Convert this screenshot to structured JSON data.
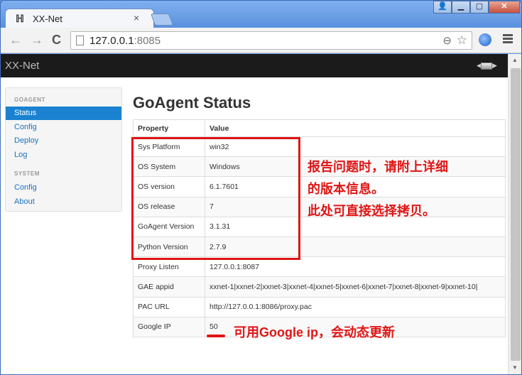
{
  "window": {
    "tab_title": "XX-Net",
    "tab_close": "×",
    "tab_icon": "ladder-icon",
    "buttons": [
      "user-icon",
      "minimize-icon",
      "maximize-icon",
      "close-icon"
    ],
    "button_glyphs": [
      "👤",
      "▁",
      "▢",
      "✕"
    ]
  },
  "toolbar": {
    "back": "←",
    "forward": "→",
    "reload": "C",
    "url_host": "127.0.0.1",
    "url_port": ":8085"
  },
  "navbar": {
    "brand": "XX-Net"
  },
  "sidebar": {
    "header_goagent": "GOAGENT",
    "header_system": "SYSTEM",
    "items": [
      {
        "label": "Status",
        "active": true
      },
      {
        "label": "Config"
      },
      {
        "label": "Deploy"
      },
      {
        "label": "Log"
      },
      {
        "label": "Config"
      },
      {
        "label": "About"
      }
    ]
  },
  "main": {
    "title": "GoAgent Status",
    "table": {
      "headers": [
        "Property",
        "Value"
      ],
      "rows": [
        [
          "Sys Platform",
          "win32"
        ],
        [
          "OS System",
          "Windows"
        ],
        [
          "OS version",
          "6.1.7601"
        ],
        [
          "OS release",
          "7"
        ],
        [
          "GoAgent Version",
          "3.1.31"
        ],
        [
          "Python Version",
          "2.7.9"
        ],
        [
          "Proxy Listen",
          "127.0.0.1:8087"
        ],
        [
          "GAE appid",
          "xxnet-1|xxnet-2|xxnet-3|xxnet-4|xxnet-5|xxnet-6|xxnet-7|xxnet-8|xxnet-9|xxnet-10|"
        ],
        [
          "PAC URL",
          "http://127.0.0.1:8086/proxy.pac"
        ],
        [
          "Google IP",
          "50"
        ]
      ]
    }
  },
  "annotations": {
    "box_note_line1": "报告问题时，请附上详细",
    "box_note_line2": "的版本信息。",
    "box_note_line3": "此处可直接选择拷贝。",
    "ip_note": "可用Google ip，会动态更新"
  },
  "colors": {
    "annotation": "#e01515",
    "active_nav": "#1a82d0",
    "link": "#1a72c4"
  }
}
